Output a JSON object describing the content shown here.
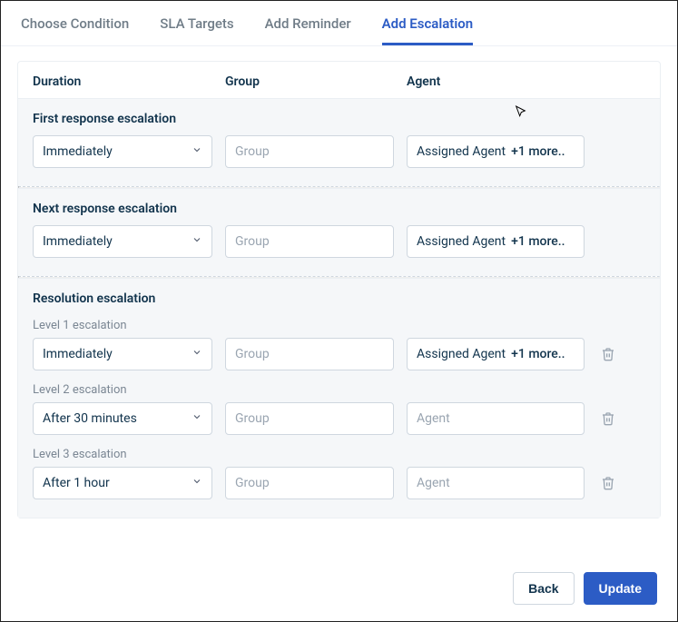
{
  "tabs": {
    "choose": "Choose Condition",
    "sla": "SLA Targets",
    "reminder": "Add Reminder",
    "escalation": "Add Escalation"
  },
  "columns": {
    "duration": "Duration",
    "group": "Group",
    "agent": "Agent"
  },
  "placeholders": {
    "group": "Group",
    "agent": "Agent"
  },
  "sections": {
    "first": {
      "title": "First response escalation",
      "duration": "Immediately",
      "agent_label": "Assigned Agent",
      "agent_more": "+1 more.."
    },
    "next": {
      "title": "Next response escalation",
      "duration": "Immediately",
      "agent_label": "Assigned Agent",
      "agent_more": "+1 more.."
    },
    "resolution": {
      "title": "Resolution escalation",
      "levels": [
        {
          "label": "Level 1 escalation",
          "duration": "Immediately",
          "agent_label": "Assigned Agent",
          "agent_more": "+1 more.."
        },
        {
          "label": "Level 2 escalation",
          "duration": "After 30 minutes",
          "agent_label": "",
          "agent_more": ""
        },
        {
          "label": "Level 3 escalation",
          "duration": "After 1 hour",
          "agent_label": "",
          "agent_more": ""
        }
      ]
    }
  },
  "footer": {
    "back": "Back",
    "update": "Update"
  }
}
